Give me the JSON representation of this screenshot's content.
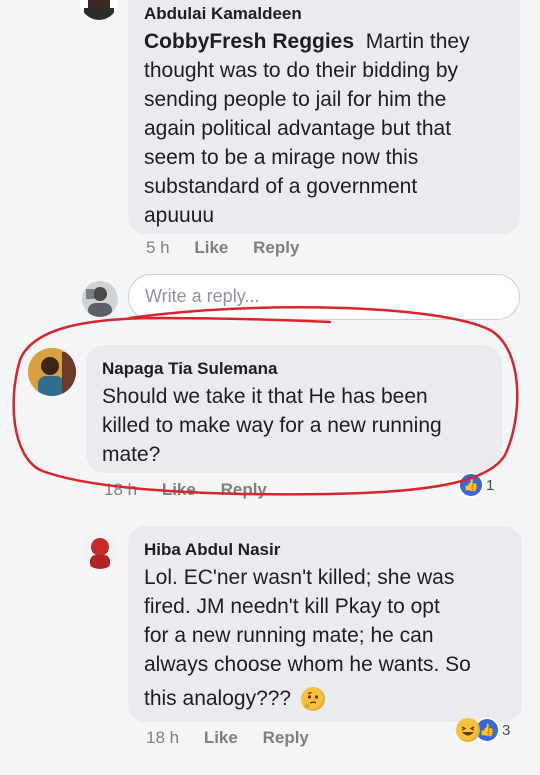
{
  "comments": [
    {
      "author": "Abdulai Kamaldeen",
      "tagged": "CobbyFresh Reggies",
      "lines": [
        "Martin they",
        "thought was to do their bidding by",
        "sending people to jail for him the",
        "again political advantage but that",
        "seem to be a mirage now this",
        "substandard of a government",
        "apuuuu"
      ],
      "time": "5 h",
      "like_label": "Like",
      "reply_label": "Reply"
    },
    {
      "author": "Napaga Tia Sulemana",
      "lines": [
        "Should we take it that He has been",
        "killed to make way for a new running",
        "mate?"
      ],
      "time": "18 h",
      "like_label": "Like",
      "reply_label": "Reply",
      "reactions": {
        "count": "1"
      }
    },
    {
      "author": "Hiba Abdul Nasir",
      "lines": [
        "Lol. EC'ner wasn't killed; she was",
        "fired. JM needn't kill Pkay to opt",
        "for a new running mate; he can",
        "always choose whom he wants. So",
        "this analogy???"
      ],
      "time": "18 h",
      "like_label": "Like",
      "reply_label": "Reply",
      "reactions": {
        "count": "3"
      }
    }
  ],
  "reply_box": {
    "placeholder": "Write a reply..."
  },
  "colors": {
    "bubble": "#e9ebee",
    "background": "#f4f5f7",
    "annotation_red": "#d6262b",
    "like_blue": "#3b68d8"
  },
  "icons": [
    "thinking-face-emoji",
    "laughing-emoji",
    "like-reaction-icon"
  ]
}
